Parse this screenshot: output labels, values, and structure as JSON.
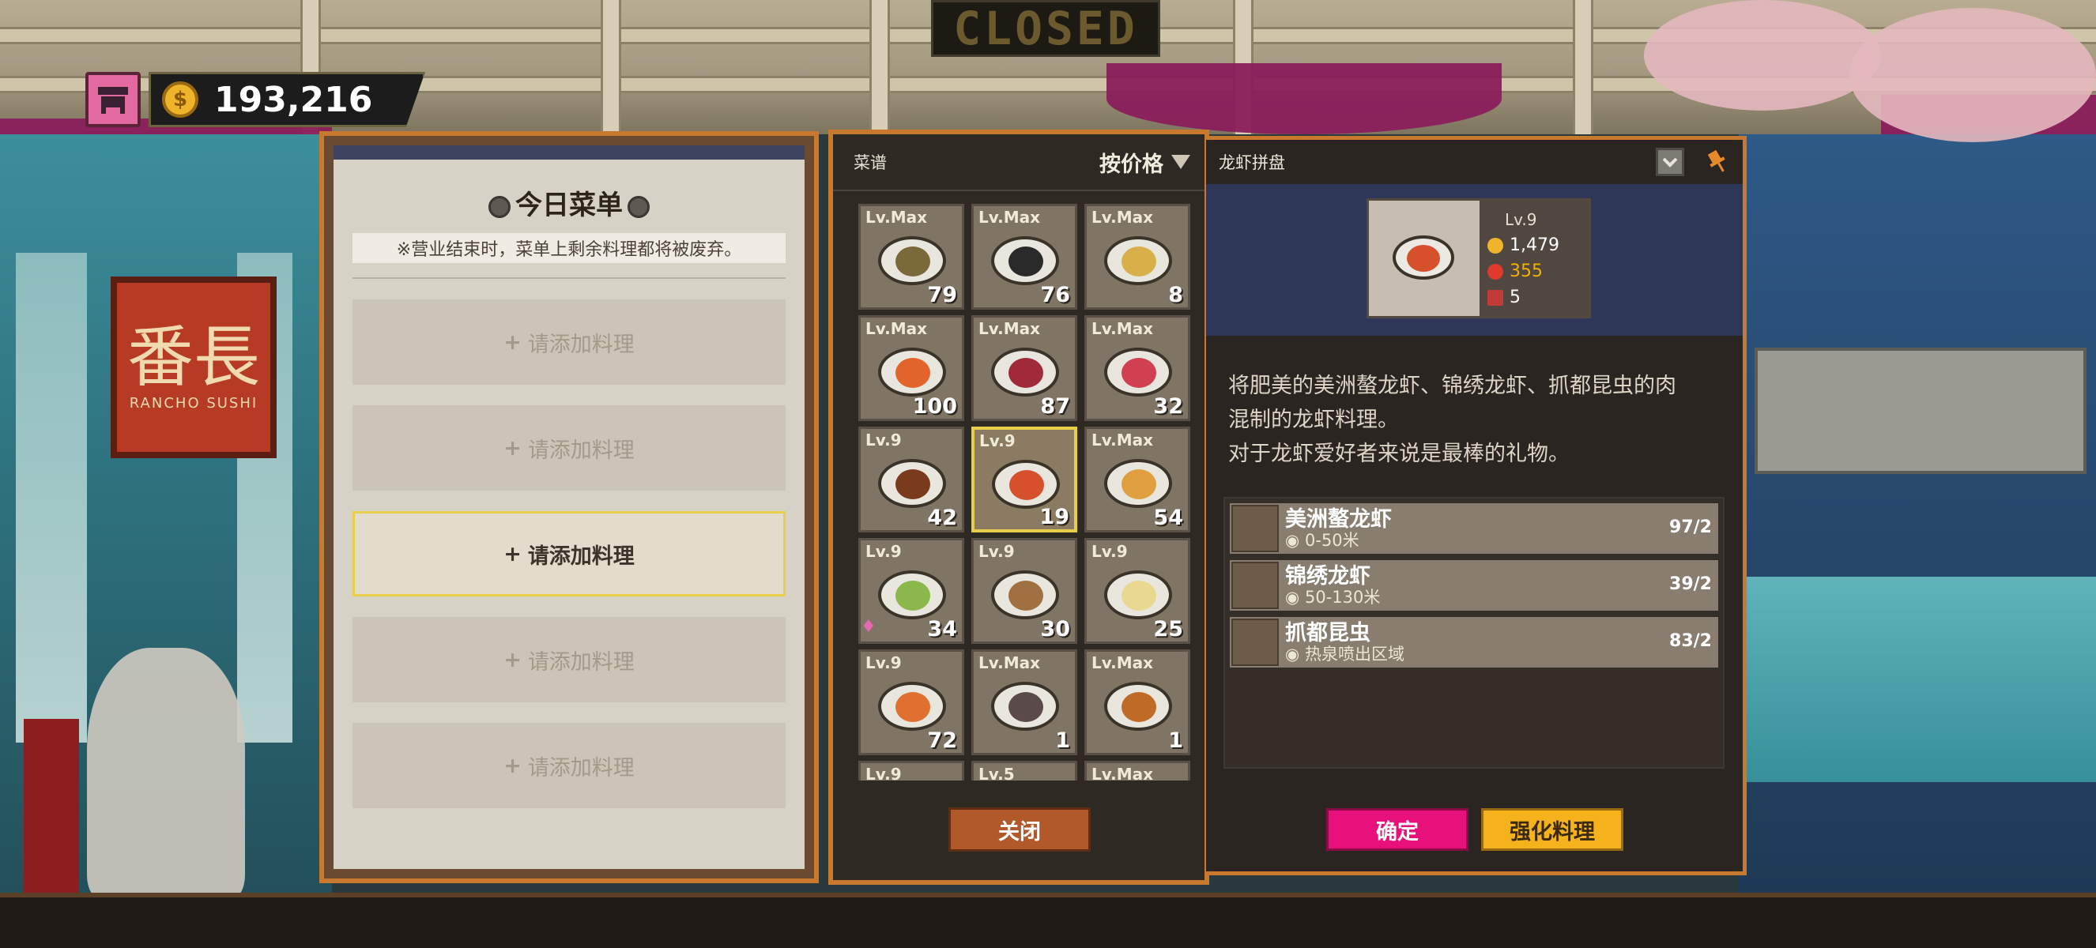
{
  "sign": {
    "closed": "CLOSED"
  },
  "background_sign": {
    "kanji": "番長",
    "text": "RANCHO SUSHI"
  },
  "currency": {
    "amount": "193,216",
    "coin_symbol": "$"
  },
  "menu_panel": {
    "title": "今日菜单",
    "note": "※营业结束时，菜单上剩余料理都将被废弃。",
    "slots": [
      {
        "label": "请添加料理",
        "active": false
      },
      {
        "label": "请添加料理",
        "active": false
      },
      {
        "label": "请添加料理",
        "active": true
      },
      {
        "label": "请添加料理",
        "active": false
      },
      {
        "label": "请添加料理",
        "active": false
      }
    ]
  },
  "recipe_panel": {
    "title": "菜谱",
    "sort_label": "按价格",
    "dishes": [
      {
        "level": "Lv.Max",
        "count": "79",
        "color": "#7a6a3a"
      },
      {
        "level": "Lv.Max",
        "count": "76",
        "color": "#2a2a2a"
      },
      {
        "level": "Lv.Max",
        "count": "8",
        "color": "#d8b04a"
      },
      {
        "level": "Lv.Max",
        "count": "100",
        "color": "#e2642a"
      },
      {
        "level": "Lv.Max",
        "count": "87",
        "color": "#a02a3a"
      },
      {
        "level": "Lv.Max",
        "count": "32",
        "color": "#d04050"
      },
      {
        "level": "Lv.9",
        "count": "42",
        "color": "#7a3a1c"
      },
      {
        "level": "Lv.9",
        "count": "19",
        "color": "#d6502c",
        "selected": true
      },
      {
        "level": "Lv.Max",
        "count": "54",
        "color": "#e0a040"
      },
      {
        "level": "Lv.9",
        "count": "34",
        "color": "#8ab84a",
        "bow": true
      },
      {
        "level": "Lv.9",
        "count": "30",
        "color": "#a07040"
      },
      {
        "level": "Lv.9",
        "count": "25",
        "color": "#e8d890"
      },
      {
        "level": "Lv.9",
        "count": "72",
        "color": "#e07030"
      },
      {
        "level": "Lv.Max",
        "count": "1",
        "color": "#5a4a4a"
      },
      {
        "level": "Lv.Max",
        "count": "1",
        "color": "#c06a28"
      },
      {
        "level": "Lv.9",
        "count": "",
        "color": "#888888"
      },
      {
        "level": "Lv.5",
        "count": "",
        "color": "#888888"
      },
      {
        "level": "Lv.Max",
        "count": "",
        "color": "#888888"
      }
    ],
    "close_label": "关闭"
  },
  "detail_panel": {
    "title": "龙虾拼盘",
    "level": "Lv.9",
    "price": "1,479",
    "taste": "355",
    "servings": "5",
    "description": [
      "将肥美的美洲螯龙虾、锦绣龙虾、抓都昆虫的肉",
      "混制的龙虾料理。",
      "对于龙虾爱好者来说是最棒的礼物。"
    ],
    "ingredients": [
      {
        "name": "美洲螯龙虾",
        "location": "0-50米",
        "qty": "97/2"
      },
      {
        "name": "锦绣龙虾",
        "location": "50-130米",
        "qty": "39/2"
      },
      {
        "name": "抓都昆虫",
        "location": "热泉喷出区域",
        "qty": "83/2"
      }
    ],
    "confirm_label": "确定",
    "enhance_label": "强化料理"
  },
  "colors": {
    "panel_border": "#c8792e",
    "confirm": "#e8107a",
    "enhance": "#f6b21c",
    "taste_text": "#f0b000"
  }
}
